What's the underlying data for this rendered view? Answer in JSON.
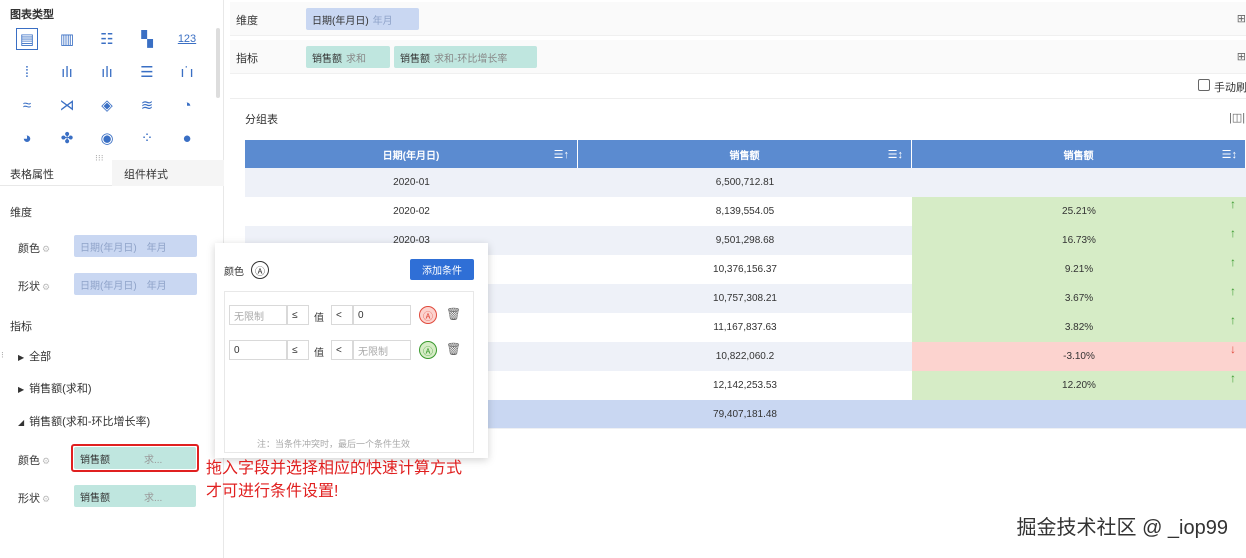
{
  "left_panel": {
    "chart_type_title": "图表类型",
    "chart_icons": [
      [
        "table-icon",
        "cross-table-icon",
        "detail-table-icon",
        "kpi-icon",
        "number-icon"
      ],
      [
        "grouped-bar-icon",
        "bar-icon",
        "stacked-bar-icon",
        "horizontal-bar-icon",
        "waterfall-icon"
      ],
      [
        "line-icon",
        "radar-icon",
        "polar-icon",
        "area-icon",
        "gauge-icon"
      ],
      [
        "pie-icon",
        "rose-icon",
        "ring-icon",
        "scatter-icon",
        "bubble-icon"
      ]
    ],
    "number_glyph": "123",
    "tabs": {
      "table_props": "表格属性",
      "component_style": "组件样式"
    },
    "dimension_title": "维度",
    "color_label": "颜色",
    "shape_label": "形状",
    "dim_pill": "日期(年月日)",
    "dim_pill_sub": "年月",
    "metric_title": "指标",
    "tree": [
      "全部",
      "销售额(求和)",
      "销售额(求和-环比增长率)"
    ],
    "metric_pill": "销售额",
    "metric_pill_sub": "求..."
  },
  "top": {
    "dim_label": "维度",
    "dim_pill": "日期(年月日)",
    "dim_pill_sub": "年月",
    "metric_label": "指标",
    "metric_pill1": "销售额",
    "metric_pill1_sub": "求和",
    "metric_pill2": "销售额",
    "metric_pill2_sub": "求和-环比增长率",
    "manual_refresh": "手动刷"
  },
  "table": {
    "title": "分组表",
    "headers": [
      "日期(年月日)",
      "销售额",
      "销售额"
    ],
    "rows": [
      {
        "date": "2020-01",
        "sales": "6,500,712.81",
        "growth": "",
        "dir": ""
      },
      {
        "date": "2020-02",
        "sales": "8,139,554.05",
        "growth": "25.21%",
        "dir": "up"
      },
      {
        "date": "2020-03",
        "sales": "9,501,298.68",
        "growth": "16.73%",
        "dir": "up"
      },
      {
        "date": "",
        "sales": "10,376,156.37",
        "growth": "9.21%",
        "dir": "up"
      },
      {
        "date": "",
        "sales": "10,757,308.21",
        "growth": "3.67%",
        "dir": "up"
      },
      {
        "date": "",
        "sales": "11,167,837.63",
        "growth": "3.82%",
        "dir": "up"
      },
      {
        "date": "",
        "sales": "10,822,060.2",
        "growth": "-3.10%",
        "dir": "down"
      },
      {
        "date": "",
        "sales": "12,142,253.53",
        "growth": "12.20%",
        "dir": "up"
      }
    ],
    "total_sales": "79,407,181.48",
    "colors": {
      "up_bg": "#d6ecc6",
      "down_bg": "#fcd3cf",
      "up": "#3a9a2e",
      "down": "#e04a3c",
      "header": "#5b8bd0",
      "total_bg": "#c9d7f2"
    }
  },
  "popup": {
    "color_label": "颜色",
    "add_button": "添加条件",
    "row1": {
      "min": "无限制",
      "op1": "≤",
      "value_label": "值",
      "op2": "<",
      "max": "0"
    },
    "row2": {
      "min": "0",
      "op1": "≤",
      "value_label": "值",
      "op2": "<",
      "max": "无限制"
    },
    "note": "注：当条件冲突时，最后一个条件生效"
  },
  "annotation": [
    "拖入字段并选择相应的快速计算方式",
    "才可进行条件设置!"
  ],
  "watermark": "掘金技术社区 @ _iop99"
}
